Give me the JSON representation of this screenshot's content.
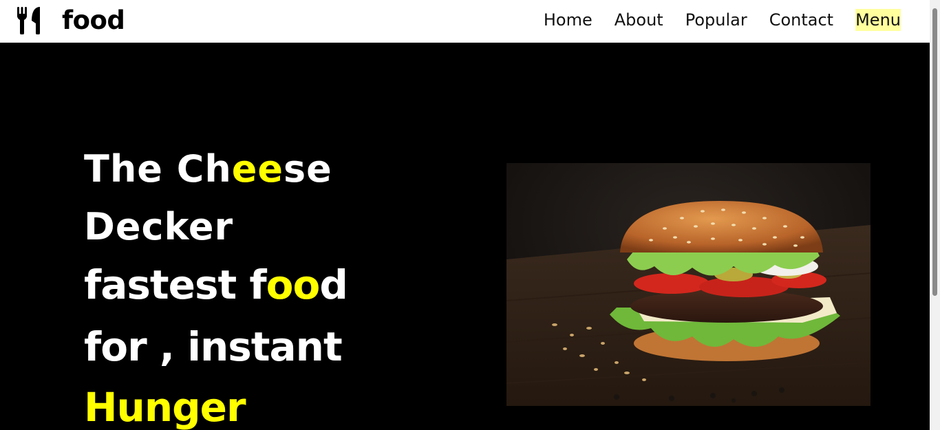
{
  "brand": {
    "name": "food",
    "icon": "fork-knife-icon"
  },
  "nav": {
    "items": [
      {
        "label": "Home",
        "active": false
      },
      {
        "label": "About",
        "active": false
      },
      {
        "label": "Popular",
        "active": false
      },
      {
        "label": "Contact",
        "active": false
      },
      {
        "label": "Menu",
        "active": true
      }
    ]
  },
  "hero": {
    "line1": {
      "pre": "The Ch",
      "highlight": "ee",
      "post": "se"
    },
    "line2": "Decker",
    "line3": {
      "pre": "fastest f",
      "highlight": "oo",
      "post": "d"
    },
    "line4": "for , instant",
    "line5": "Hunger",
    "image": "burger-photo"
  },
  "colors": {
    "accent": "#ffff00",
    "nav_active_bg": "#ffff9e",
    "hero_bg": "#000000",
    "navbar_bg": "#ffffff"
  }
}
